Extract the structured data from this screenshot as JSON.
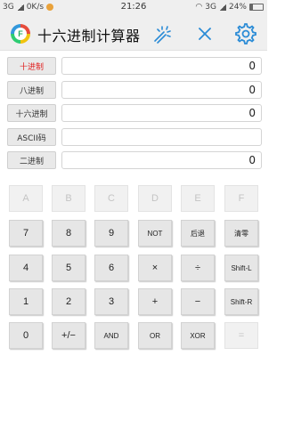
{
  "status_bar": {
    "network_left": "3G",
    "speed": "0K/s",
    "time": "21:26",
    "network_right": "3G",
    "battery": "24%",
    "battery_level": 0.24
  },
  "header": {
    "title": "十六进制计算器",
    "logo_letter": "F"
  },
  "modes": [
    {
      "label": "十进制",
      "value": "0",
      "active": true
    },
    {
      "label": "八进制",
      "value": "0",
      "active": false
    },
    {
      "label": "十六进制",
      "value": "0",
      "active": false
    },
    {
      "label": "ASCII码",
      "value": "",
      "active": false
    },
    {
      "label": "二进制",
      "value": "0",
      "active": false
    }
  ],
  "keypad": {
    "rows": [
      [
        {
          "label": "A",
          "disabled": true
        },
        {
          "label": "B",
          "disabled": true
        },
        {
          "label": "C",
          "disabled": true
        },
        {
          "label": "D",
          "disabled": true
        },
        {
          "label": "E",
          "disabled": true
        },
        {
          "label": "F",
          "disabled": true
        }
      ],
      [
        {
          "label": "7"
        },
        {
          "label": "8"
        },
        {
          "label": "9"
        },
        {
          "label": "NOT",
          "small": true
        },
        {
          "label": "后退",
          "small": true
        },
        {
          "label": "清零",
          "small": true
        }
      ],
      [
        {
          "label": "4"
        },
        {
          "label": "5"
        },
        {
          "label": "6"
        },
        {
          "label": "×"
        },
        {
          "label": "÷"
        },
        {
          "label": "Shift-L",
          "small": true
        }
      ],
      [
        {
          "label": "1"
        },
        {
          "label": "2"
        },
        {
          "label": "3"
        },
        {
          "label": "+"
        },
        {
          "label": "−"
        },
        {
          "label": "Shift-R",
          "small": true
        }
      ],
      [
        {
          "label": "0"
        },
        {
          "label": "+/−"
        },
        {
          "label": "AND",
          "small": true
        },
        {
          "label": "OR",
          "small": true
        },
        {
          "label": "XOR",
          "small": true
        },
        {
          "label": "=",
          "disabled": true
        }
      ]
    ]
  },
  "colors": {
    "accent": "#2a8bd6",
    "active_mode": "#e02020"
  }
}
